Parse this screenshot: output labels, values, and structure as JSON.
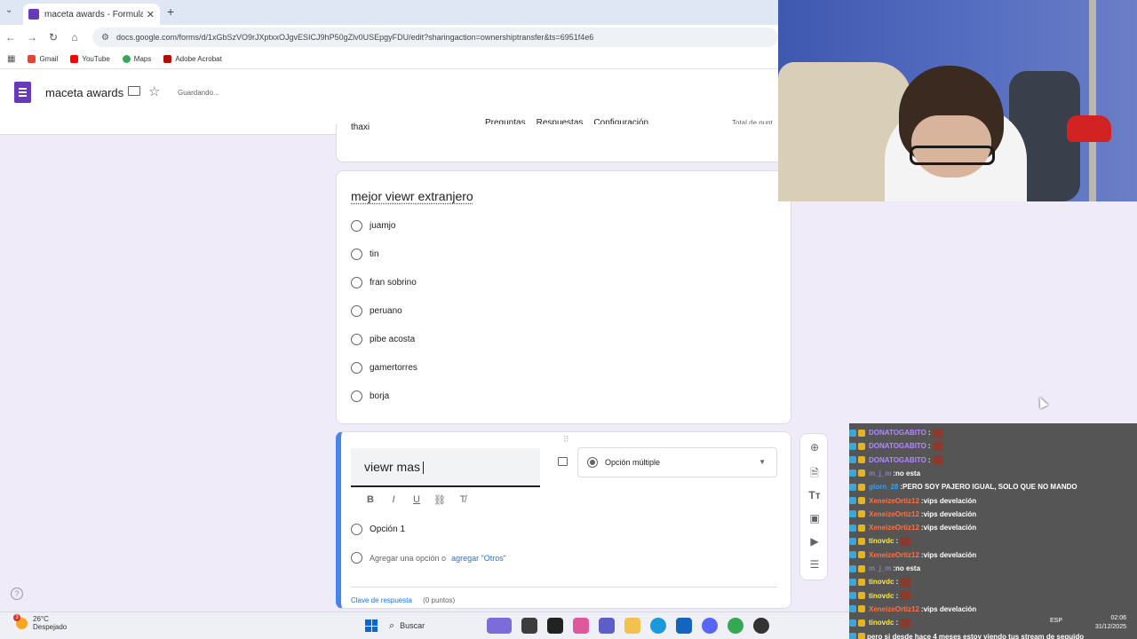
{
  "browser": {
    "tab_title": "maceta awards - Formularios d",
    "url": "docs.google.com/forms/d/1xGbSzVO9rJXptxxOJgvESICJ9hP50gZlv0USEpgyFDU/edit?sharingaction=ownershiptransfer&ts=6951f4e6",
    "bookmarks": [
      "Gmail",
      "YouTube",
      "Maps",
      "Adobe Acrobat"
    ]
  },
  "forms": {
    "title": "maceta awards",
    "status": "Guardando...",
    "tabs": [
      "Preguntas",
      "Respuestas",
      "Configuración"
    ],
    "active_tab": "Preguntas",
    "total_points": "Total de punt"
  },
  "prev_question": {
    "partial_option": "thaxi"
  },
  "question": {
    "title": "mejor viewr extranjero",
    "options": [
      "juamjo",
      "tin",
      "fran sobrino",
      "peruano",
      "pibe acosta",
      "gamertorres",
      "borja"
    ]
  },
  "editing": {
    "title": "viewr mas",
    "type": "Opción múltiple",
    "option1": "Opción 1",
    "add_option": "Agregar una opción o",
    "add_other": "agregar \"Otros\"",
    "answer_key": "Clave de respuesta",
    "points": "(0 puntos)"
  },
  "chat": [
    {
      "user": "DONATOGABITO",
      "msg": "",
      "emote": true,
      "color": "#b388ff"
    },
    {
      "user": "DONATOGABITO",
      "msg": "",
      "emote": true,
      "color": "#b388ff"
    },
    {
      "user": "DONATOGABITO",
      "msg": "",
      "emote": true,
      "color": "#b388ff"
    },
    {
      "user": "m_j_m",
      "msg": "no esta",
      "emote": false,
      "color": "#8e7cc3"
    },
    {
      "user": "glorn_28",
      "msg": "PERO SOY PAJERO IGUAL, SOLO QUE NO MANDO",
      "emote": false,
      "color": "#2ea3ff"
    },
    {
      "user": "XeneizeOrtiz12",
      "msg": "vips develación",
      "emote": false,
      "color": "#ff7043"
    },
    {
      "user": "XeneizeOrtiz12",
      "msg": "vips develación",
      "emote": false,
      "color": "#ff7043"
    },
    {
      "user": "XeneizeOrtiz12",
      "msg": "vips develación",
      "emote": false,
      "color": "#ff7043"
    },
    {
      "user": "tinovdc",
      "msg": "",
      "emote": true,
      "color": "#ffeb3b"
    },
    {
      "user": "XeneizeOrtiz12",
      "msg": "vips develación",
      "emote": false,
      "color": "#ff7043"
    },
    {
      "user": "m_j_m",
      "msg": "no esta",
      "emote": false,
      "color": "#8e7cc3"
    },
    {
      "user": "tinovdc",
      "msg": "",
      "emote": true,
      "color": "#ffeb3b"
    },
    {
      "user": "tinovdc",
      "msg": "",
      "emote": true,
      "color": "#ffeb3b"
    },
    {
      "user": "XeneizeOrtiz12",
      "msg": "vips develación",
      "emote": false,
      "color": "#ff7043"
    },
    {
      "user": "tinovdc",
      "msg": "",
      "emote": true,
      "color": "#ffeb3b"
    },
    {
      "user": "",
      "msg": "pero si desde hace 4 meses estoy viendo tus stream de seguido",
      "emote": false,
      "color": "#ffffff"
    }
  ],
  "taskbar": {
    "temperature": "26°C",
    "weather": "Despejado",
    "search_placeholder": "Buscar",
    "lang": "ESP",
    "time": "02:06",
    "date": "31/12/2025",
    "notif_count": "3"
  }
}
